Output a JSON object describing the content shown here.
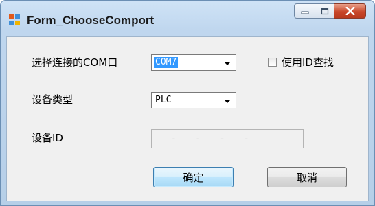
{
  "window": {
    "title": "Form_ChooseComport",
    "icon": "windows-form-icon",
    "caption_buttons": [
      "minimize-icon",
      "maximize-icon",
      "close-icon"
    ],
    "colors": {
      "close_button": "#c9472a",
      "frame": "#bfd6ee",
      "selection": "#3399ff"
    }
  },
  "form": {
    "com_label": "选择连接的COM口",
    "com_value": "COM7",
    "use_id_label": "使用ID查找",
    "use_id_checked": false,
    "device_type_label": "设备类型",
    "device_type_value": "PLC",
    "device_id_label": "设备ID",
    "device_id_mask": "-   -   -   -"
  },
  "buttons": {
    "ok": "确定",
    "cancel": "取消"
  }
}
